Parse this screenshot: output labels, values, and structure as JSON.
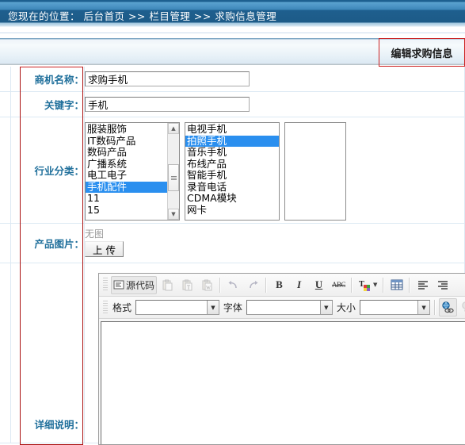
{
  "breadcrumb": {
    "prefix": "您现在的位置：",
    "text": "您现在的位置： 后台首页 >> 栏目管理 >> 求购信息管理",
    "items": [
      "后台首页",
      "栏目管理",
      "求购信息管理"
    ],
    "separator": ">>"
  },
  "panel": {
    "title": "编辑求购信息",
    "title_highlight_color": "#cc2222",
    "label_color": "#1f6f9b"
  },
  "form": {
    "fields": [
      {
        "label": "商机名称：",
        "value": "求购手机",
        "placeholder": ""
      },
      {
        "label": "关键字：",
        "value": "手机",
        "placeholder": ""
      },
      {
        "label": "行业分类：",
        "value": "",
        "placeholder": ""
      },
      {
        "label": "产品图片：",
        "value": "",
        "placeholder": ""
      },
      {
        "label": "详细说明：",
        "value": "",
        "placeholder": ""
      }
    ]
  },
  "industry": {
    "label": "行业分类：",
    "list_industry": {
      "name": "industry-list",
      "items": [
        "服装服饰",
        "IT数码产品",
        "数码产品",
        "广播系统",
        "电工电子",
        "手机配件",
        "11",
        "15"
      ],
      "selected": "手机配件",
      "selected_index": 5
    },
    "list_category": {
      "name": "category-list",
      "items": [
        "电视手机",
        "拍照手机",
        "音乐手机",
        "布线产品",
        "智能手机",
        "录音电话",
        "CDMA模块",
        "网卡"
      ],
      "selected": "拍照手机",
      "selected_index": 1
    },
    "list_selected": {
      "name": "selected-list",
      "items": [],
      "selected": "",
      "selected_index": -1
    },
    "selection_color": "#2a8fef"
  },
  "picture": {
    "label": "产品图片：",
    "no_image_text": "无图",
    "upload_label": "上 传"
  },
  "description": {
    "label": "详细说明：",
    "editor": {
      "toolbar_row1": [
        {
          "name": "source-code-button",
          "label": "源代码",
          "icon": "source-icon",
          "state": "active"
        },
        {
          "name": "paste-button",
          "label": "",
          "icon": "paste-icon",
          "state": "disabled"
        },
        {
          "name": "paste-text-button",
          "label": "",
          "icon": "paste-text-icon",
          "state": "disabled"
        },
        {
          "name": "paste-word-button",
          "label": "",
          "icon": "paste-word-icon",
          "state": "disabled"
        },
        {
          "name": "undo-button",
          "label": "",
          "icon": "undo-icon",
          "state": "disabled"
        },
        {
          "name": "redo-button",
          "label": "",
          "icon": "redo-icon",
          "state": "disabled"
        },
        {
          "name": "bold-button",
          "label": "B",
          "icon": "bold-icon",
          "state": "normal"
        },
        {
          "name": "italic-button",
          "label": "I",
          "icon": "italic-icon",
          "state": "normal"
        },
        {
          "name": "underline-button",
          "label": "U",
          "icon": "underline-icon",
          "state": "normal"
        },
        {
          "name": "strikethrough-button",
          "label": "ABC",
          "icon": "strikethrough-icon",
          "state": "normal"
        },
        {
          "name": "text-color-button",
          "label": "T",
          "icon": "text-color-icon",
          "state": "normal"
        },
        {
          "name": "table-button",
          "label": "",
          "icon": "table-icon",
          "state": "normal"
        },
        {
          "name": "align-left-button",
          "label": "",
          "icon": "align-left-icon",
          "state": "normal"
        },
        {
          "name": "align-right-button",
          "label": "",
          "icon": "align-right-icon",
          "state": "normal"
        }
      ],
      "toolbar_row2": [
        {
          "name": "format-label",
          "label": "格式"
        },
        {
          "name": "format-select",
          "label": "",
          "value": ""
        },
        {
          "name": "font-label",
          "label": "字体"
        },
        {
          "name": "font-select",
          "label": "",
          "value": ""
        },
        {
          "name": "size-label",
          "label": "大小"
        },
        {
          "name": "size-select",
          "label": "",
          "value": ""
        },
        {
          "name": "link-button",
          "label": "",
          "icon": "link-icon",
          "state": "normal"
        },
        {
          "name": "unlink-button",
          "label": "",
          "icon": "unlink-icon",
          "state": "disabled"
        }
      ],
      "content": ""
    }
  }
}
